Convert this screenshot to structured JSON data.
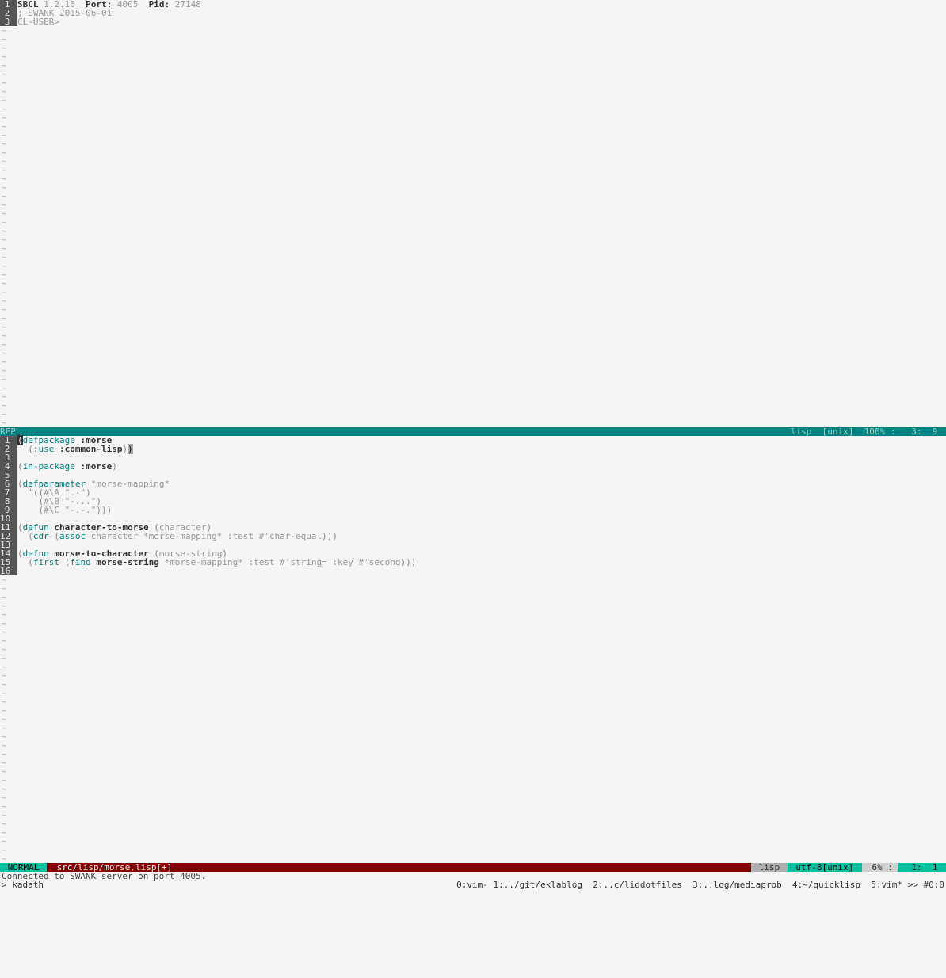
{
  "repl": {
    "lines": [
      {
        "n": "1",
        "html": "<span class='bold'>SBCL</span> <span class='dim'>1.2.16</span>  <span class='bold'>Port:</span> <span class='dim'>4005</span>  <span class='bold'>Pid:</span> <span class='dim'>27148</span>"
      },
      {
        "n": "2",
        "html": "<span class='dim'>; SWANK 2015-06-01</span>"
      },
      {
        "n": "3",
        "html": "<span class='dim'>CL-USER&gt;</span>"
      }
    ],
    "status": {
      "left": "REPL",
      "right": "lisp  [unix]  100% :   3:  9 "
    },
    "tilde_count": 46
  },
  "editor": {
    "lines": [
      {
        "n": "1",
        "html": "<span class='cursor-block'>(</span><span class='fn'>defpackage</span> <span class='bold'>:morse</span>"
      },
      {
        "n": "2",
        "html": "  <span class='paren'>(</span><span class='fn'>:use</span> <span class='bold'>:common-lisp</span><span class='paren'>)</span><span class='cursor'>)</span>"
      },
      {
        "n": "3",
        "html": ""
      },
      {
        "n": "4",
        "html": "<span class='paren'>(</span><span class='fn'>in-package</span> <span class='bold'>:morse</span><span class='paren'>)</span>"
      },
      {
        "n": "5",
        "html": ""
      },
      {
        "n": "6",
        "html": "<span class='paren'>(</span><span class='fn'>defparameter</span> <span class='dim'>*morse-mapping*</span>"
      },
      {
        "n": "7",
        "html": "  <span class='paren'>'((</span><span class='dim'>#\\A \".-\"</span><span class='paren'>)</span>"
      },
      {
        "n": "8",
        "html": "    <span class='paren'>(</span><span class='dim'>#\\B \"-...\"</span><span class='paren'>)</span>"
      },
      {
        "n": "9",
        "html": "    <span class='paren'>(</span><span class='dim'>#\\C \"-.-.\"</span><span class='paren'>)))</span>"
      },
      {
        "n": "10",
        "html": ""
      },
      {
        "n": "11",
        "html": "<span class='paren'>(</span><span class='fn'>defun</span> <span class='bold'>character-to-morse</span> <span class='paren'>(</span><span class='dim'>character</span><span class='paren'>)</span>"
      },
      {
        "n": "12",
        "html": "  <span class='paren'>(</span><span class='fn'>cdr</span> <span class='paren'>(</span><span class='fn'>assoc</span> <span class='dim'>character *morse-mapping* :test #'char-equal</span><span class='paren'>)))</span>"
      },
      {
        "n": "13",
        "html": ""
      },
      {
        "n": "14",
        "html": "<span class='paren'>(</span><span class='fn'>defun</span> <span class='bold'>morse-to-character</span> <span class='paren'>(</span><span class='dim'>morse-string</span><span class='paren'>)</span>"
      },
      {
        "n": "15",
        "html": "  <span class='paren'>(</span><span class='fn'>first</span> <span class='paren'>(</span><span class='fn'>find</span> <span class='bold'>morse-string</span> <span class='dim'>*morse-mapping* :test #'string= :key #'second</span><span class='paren'>)))</span>"
      },
      {
        "n": "16",
        "html": ""
      }
    ],
    "tilde_count": 33
  },
  "status": {
    "mode": " NORMAL ",
    "file": " src/lisp/morse.lisp[+]",
    "lisp": " lisp ",
    "enc": " utf-8[unix] ",
    "pct": " 6% :",
    "pos": "  1:  1 "
  },
  "message": "Connected to SWANK server on port 4005.",
  "tmux": {
    "left": "> kadath",
    "right": "0:vim- 1:../git/eklablog  2:..c/liddotfiles  3:..log/mediaprob  4:~/quicklisp  5:vim* >> #0:0"
  }
}
